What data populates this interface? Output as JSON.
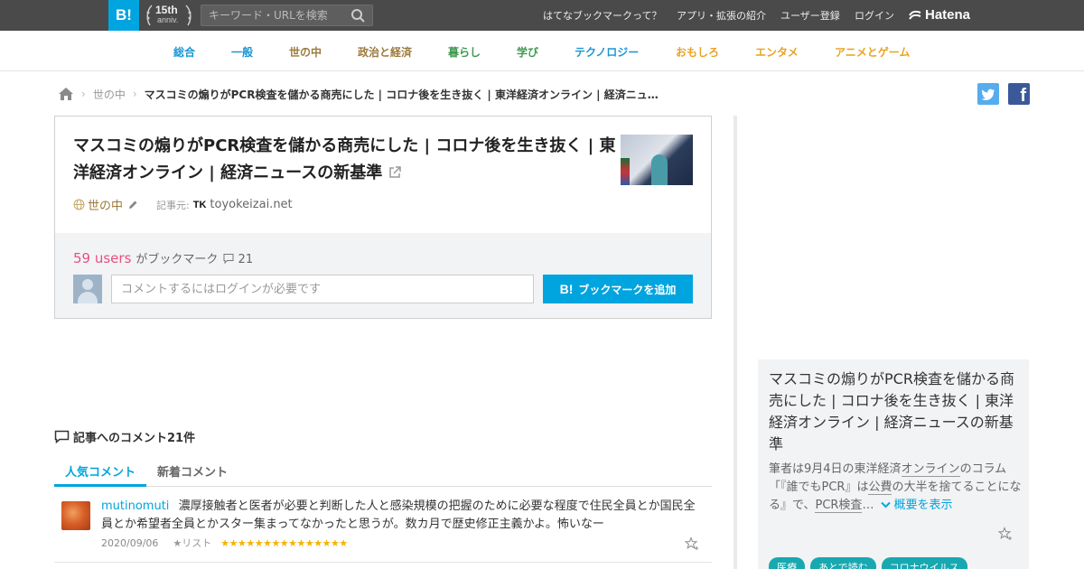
{
  "header": {
    "logo": "B!",
    "anniv_num": "15th",
    "anniv_sub": "anniv.",
    "search_placeholder": "キーワード・URLを検索",
    "links": [
      "はてなブックマークって？",
      "アプリ・拡張の紹介",
      "ユーザー登録",
      "ログイン"
    ],
    "brand": "Hatena"
  },
  "categories": [
    {
      "label": "総合",
      "color": "#1a96d4"
    },
    {
      "label": "一般",
      "color": "#1a96d4"
    },
    {
      "label": "世の中",
      "color": "#9c7a3c"
    },
    {
      "label": "政治と経済",
      "color": "#9c7a3c"
    },
    {
      "label": "暮らし",
      "color": "#3e9a4f"
    },
    {
      "label": "学び",
      "color": "#3e9a4f"
    },
    {
      "label": "テクノロジー",
      "color": "#1a96d4"
    },
    {
      "label": "おもしろ",
      "color": "#e9a320"
    },
    {
      "label": "エンタメ",
      "color": "#e9a320"
    },
    {
      "label": "アニメとゲーム",
      "color": "#e9a320"
    }
  ],
  "breadcrumb": {
    "category": "世の中",
    "title": "マスコミの煽りがPCR検査を儲かる商売にした | コロナ後を生き抜く | 東洋経済オンライン | 経済ニュースの新基準"
  },
  "entry": {
    "title": "マスコミの煽りがPCR検査を儲かる商売にした | コロナ後を生き抜く | 東洋経済オンライン | 経済ニュースの新基準",
    "category": "世の中",
    "source_label": "記事元:",
    "source_logo": "TK",
    "source_domain": "toyokeizai.net",
    "users_count": "59 users",
    "users_suffix": "がブックマーク",
    "comment_count": "21",
    "comment_placeholder": "コメントするにはログインが必要です",
    "add_button": "ブックマークを追加",
    "add_button_logo": "B!"
  },
  "comments": {
    "heading": "記事へのコメント21件",
    "tabs": [
      "人気コメント",
      "新着コメント"
    ],
    "items": [
      {
        "user": "mutinomuti",
        "text": "濃厚接触者と医者が必要と判断した人と感染規模の把握のために必要な程度で住民全員とか国民全員とか希望者全員とかスター集まってなかったと思うが。数カ月で歴史修正主義かよ。怖いなー",
        "date": "2020/09/06",
        "list_label": "★リスト",
        "stars": "★★★★★★★★★★★★★★★"
      }
    ]
  },
  "summary": {
    "title": "マスコミの煽りがPCR検査を儲かる商売にした | コロナ後を生き抜く | 東洋経済オンライン | 経済ニュースの新基準",
    "text_1": "筆者は9月4日の東洋経済",
    "text_u1": "オンライン",
    "text_2": "のコラム「『誰でもPCR』は",
    "text_u2": "公費",
    "text_3": "の大半を捨てることになる』で、",
    "text_u3": "PCR検査",
    "text_4": "…",
    "more": "概要を表示",
    "tags": [
      "医療",
      "あとで読む",
      "コロナウイルス"
    ]
  }
}
